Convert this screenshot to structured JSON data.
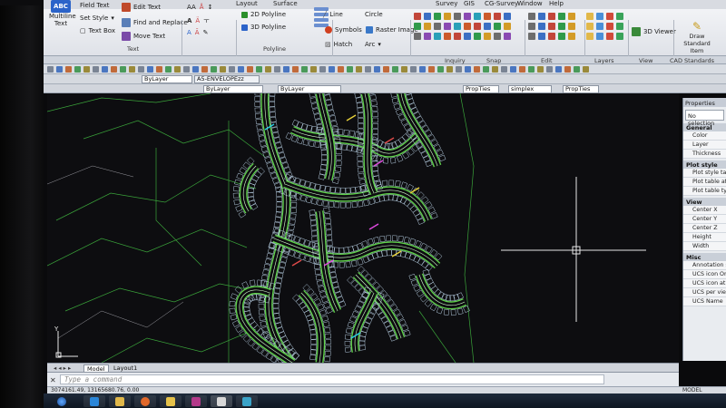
{
  "menu": [
    "Layout",
    "Surface",
    "Survey",
    "GIS",
    "CG-Survey",
    "Window",
    "Help"
  ],
  "ribbon": {
    "text_group": {
      "multiline_label": "Multiline Text",
      "field_text": "Field Text",
      "set_style": "Set Style",
      "text_box": "Text Box",
      "edit_text": "Edit Text",
      "find_replace": "Find and Replace",
      "move_text": "Move Text",
      "panel": "Text"
    },
    "polyline_group": {
      "p2d": "2D Polyline",
      "p3d": "3D Polyline",
      "panel": "Polyline"
    },
    "draw_group": {
      "line": "Line",
      "circle": "Circle",
      "symbols": "Symbols",
      "raster_image": "Raster Image",
      "hatch": "Hatch",
      "arc": "Arc",
      "panel": "Draw"
    },
    "panels": [
      "Inquiry",
      "Snap",
      "Edit",
      "Layers",
      "View"
    ],
    "view_3d": "3D Viewer",
    "draw_standard": "Draw Standard Item",
    "cad_standards": "CAD Standards"
  },
  "toolbar": {
    "layer_dropdown": "ByLayer",
    "layer_name": "A5-ENVELOPEzz",
    "linetype": "ByLayer",
    "lineweight": "ByLayer",
    "prop_ties_1": "PropTies",
    "style": "simplex",
    "prop_ties_2": "PropTies"
  },
  "properties": {
    "title": "Properties",
    "selection": "No selection",
    "sections": [
      {
        "name": "General",
        "rows": [
          "Color",
          "Layer",
          "Thickness"
        ]
      },
      {
        "name": "Plot style",
        "rows": [
          "Plot style table",
          "Plot table attac",
          "Plot table type"
        ]
      },
      {
        "name": "View",
        "rows": [
          "Center X",
          "Center Y",
          "Center Z",
          "Height",
          "Width"
        ]
      },
      {
        "name": "Misc",
        "rows": [
          "Annotation scale",
          "UCS icon On",
          "UCS icon at origin",
          "UCS per viewport",
          "UCS Name"
        ]
      }
    ]
  },
  "tabs": {
    "model": "Model",
    "layout1": "Layout1"
  },
  "command": {
    "placeholder": "Type a command"
  },
  "status": {
    "coords": "3074161.49, 13165680.76, 0.00",
    "model": "MODEL"
  },
  "colors": {
    "drawing_bg": "#0d0d10",
    "lot_lines": "#d8ffd0",
    "boundary": "#5fd14a",
    "ribbon_bg": "#e4e7ec"
  }
}
